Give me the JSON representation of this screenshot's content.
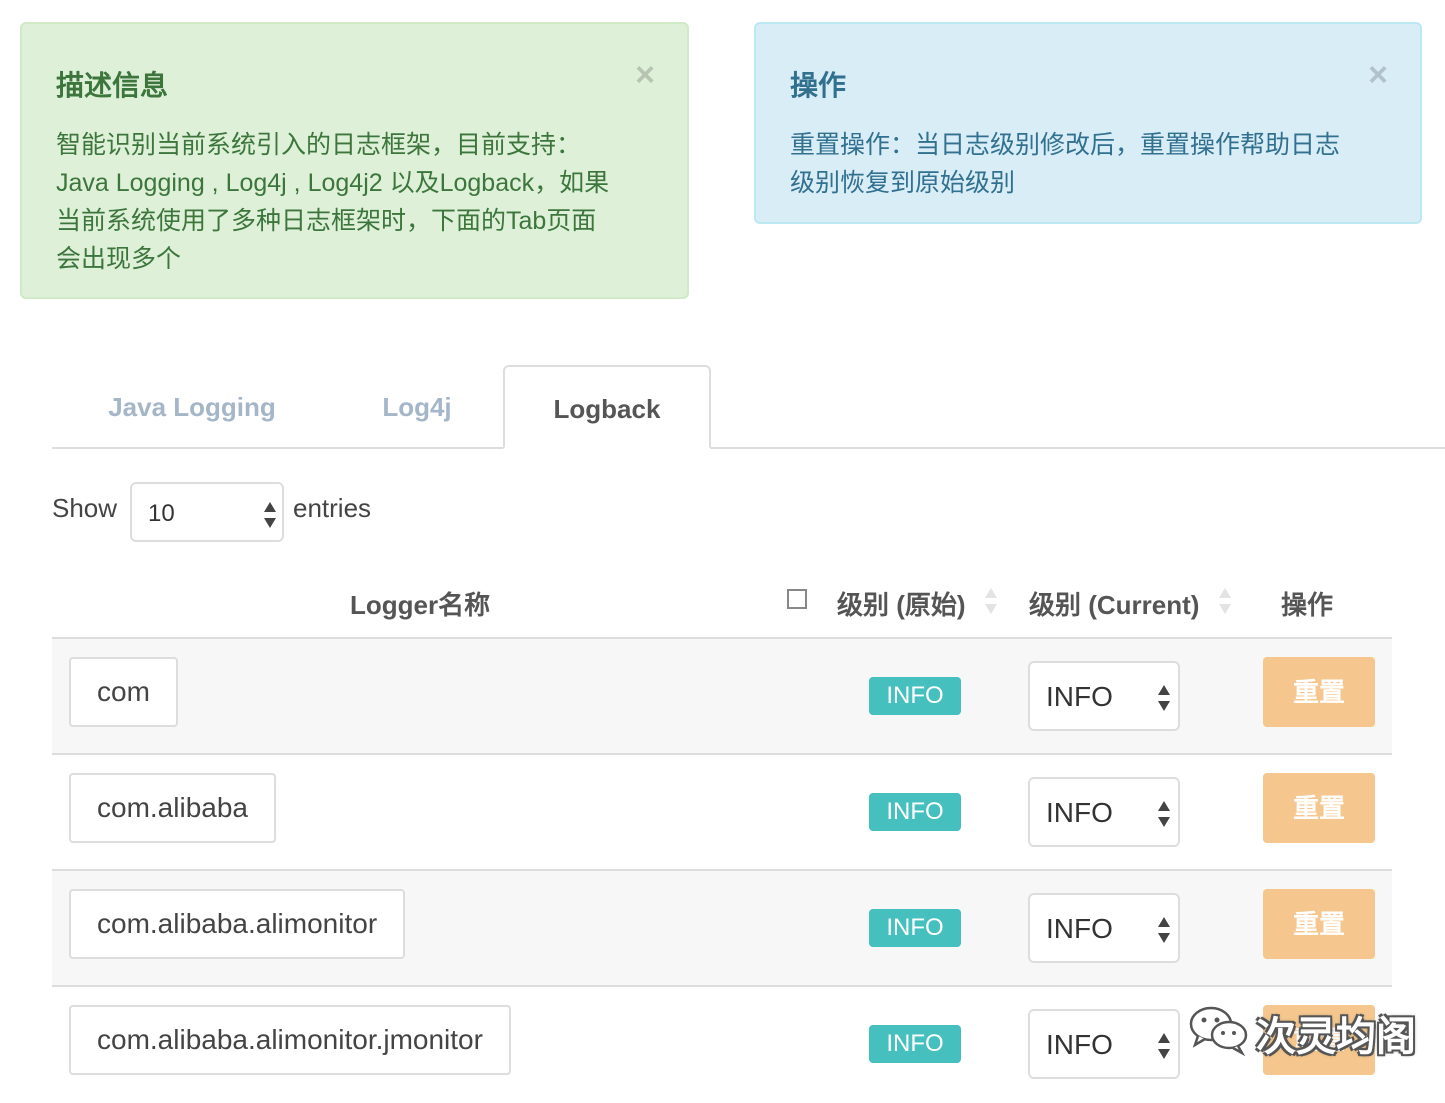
{
  "alerts": {
    "description": {
      "title": "描述信息",
      "body": "智能识别当前系统引入的日志框架，目前支持：Java Logging , Log4j , Log4j2 以及Logback，如果当前系统使用了多种日志框架时，下面的Tab页面会出现多个",
      "close": "×"
    },
    "operation": {
      "title": "操作",
      "body": "重置操作：当日志级别修改后，重置操作帮助日志级别恢复到原始级别",
      "close": "×"
    }
  },
  "tabs": [
    {
      "label": "Java Logging",
      "active": false
    },
    {
      "label": "Log4j",
      "active": false
    },
    {
      "label": "Logback",
      "active": true
    }
  ],
  "length_menu": {
    "show": "Show",
    "value": "10",
    "entries": "entries"
  },
  "table": {
    "headers": {
      "name": "Logger名称",
      "original": "级别 (原始)",
      "current": "级别 (Current)",
      "action": "操作"
    },
    "rows": [
      {
        "name": "com",
        "original": "INFO",
        "current": "INFO",
        "action": "重置"
      },
      {
        "name": "com.alibaba",
        "original": "INFO",
        "current": "INFO",
        "action": "重置"
      },
      {
        "name": "com.alibaba.alimonitor",
        "original": "INFO",
        "current": "INFO",
        "action": "重置"
      },
      {
        "name": "com.alibaba.alimonitor.jmonitor",
        "original": "INFO",
        "current": "INFO",
        "action": "重置"
      }
    ]
  },
  "watermark": {
    "text": "次灵均阁",
    "icon": "wechat-icon"
  },
  "colors": {
    "success_bg": "#dff0d8",
    "info_bg": "#d9edf7",
    "badge": "#46bfbf",
    "reset_button": "#f5c78e"
  }
}
